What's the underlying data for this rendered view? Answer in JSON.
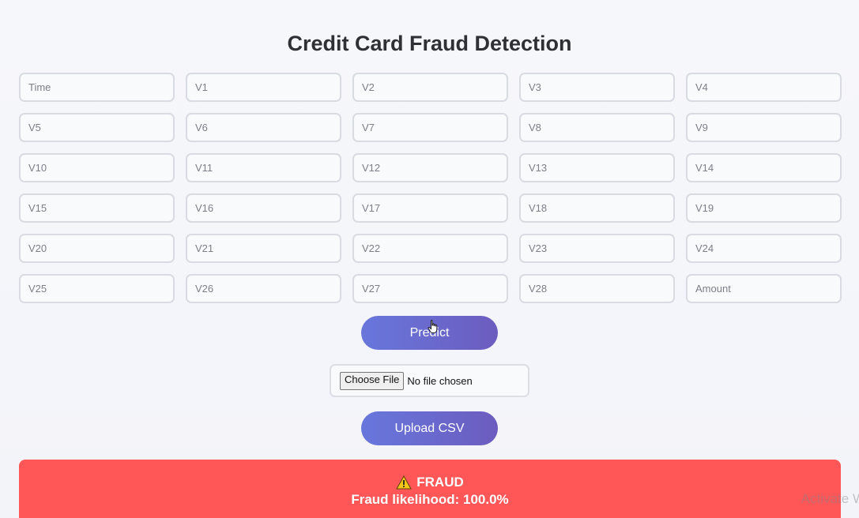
{
  "page": {
    "title": "Credit Card Fraud Detection"
  },
  "form": {
    "fields": [
      {
        "placeholder": "Time"
      },
      {
        "placeholder": "V1"
      },
      {
        "placeholder": "V2"
      },
      {
        "placeholder": "V3"
      },
      {
        "placeholder": "V4"
      },
      {
        "placeholder": "V5"
      },
      {
        "placeholder": "V6"
      },
      {
        "placeholder": "V7"
      },
      {
        "placeholder": "V8"
      },
      {
        "placeholder": "V9"
      },
      {
        "placeholder": "V10"
      },
      {
        "placeholder": "V11"
      },
      {
        "placeholder": "V12"
      },
      {
        "placeholder": "V13"
      },
      {
        "placeholder": "V14"
      },
      {
        "placeholder": "V15"
      },
      {
        "placeholder": "V16"
      },
      {
        "placeholder": "V17"
      },
      {
        "placeholder": "V18"
      },
      {
        "placeholder": "V19"
      },
      {
        "placeholder": "V20"
      },
      {
        "placeholder": "V21"
      },
      {
        "placeholder": "V22"
      },
      {
        "placeholder": "V23"
      },
      {
        "placeholder": "V24"
      },
      {
        "placeholder": "V25"
      },
      {
        "placeholder": "V26"
      },
      {
        "placeholder": "V27"
      },
      {
        "placeholder": "V28"
      },
      {
        "placeholder": "Amount"
      }
    ],
    "predict_label": "Predict"
  },
  "upload": {
    "choose_label": "Choose File",
    "status": "No file chosen",
    "upload_label": "Upload CSV"
  },
  "result": {
    "icon": "warning-icon",
    "label": "FRAUD",
    "likelihood_text": "Fraud likelihood: 100.0%",
    "color": "#ff5757"
  },
  "overlay": {
    "watermark": "Activate W"
  },
  "theme": {
    "button_gradient_start": "#6877dc",
    "button_gradient_end": "#6c5cbf"
  }
}
